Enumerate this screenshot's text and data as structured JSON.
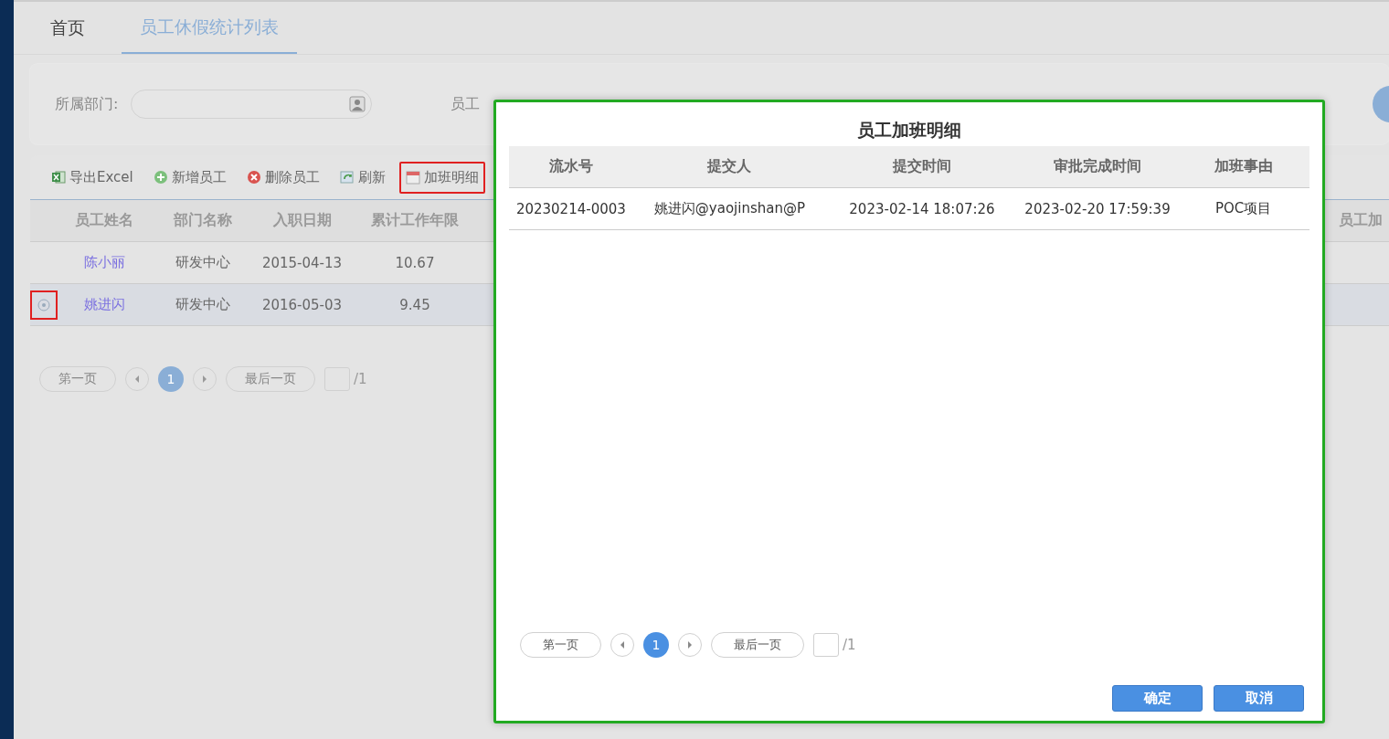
{
  "tabs": [
    {
      "label": "首页",
      "selected": false
    },
    {
      "label": "员工休假统计列表",
      "selected": true
    }
  ],
  "filter": {
    "department_label": "所属部门:",
    "employee_label": "员工"
  },
  "toolbar": [
    {
      "kind": "excel",
      "label": "导出Excel",
      "highlighted": false
    },
    {
      "kind": "add",
      "label": "新增员工",
      "highlighted": false
    },
    {
      "kind": "delete",
      "label": "删除员工",
      "highlighted": false
    },
    {
      "kind": "refresh",
      "label": "刷新",
      "highlighted": false
    },
    {
      "kind": "calendar",
      "label": "加班明细",
      "highlighted": true
    }
  ],
  "table": {
    "columns": [
      "员工姓名",
      "部门名称",
      "入职日期",
      "累计工作年限"
    ],
    "last_column": "员工加",
    "rows": [
      {
        "selected": false,
        "highlighted": false,
        "cells": [
          "陈小丽",
          "研发中心",
          "2015-04-13",
          "10.67"
        ]
      },
      {
        "selected": true,
        "highlighted": true,
        "cells": [
          "姚进闪",
          "研发中心",
          "2016-05-03",
          "9.45"
        ]
      }
    ]
  },
  "pagination": {
    "first": "第一页",
    "pages": [
      {
        "label": "1",
        "selected": true
      }
    ],
    "last": "最后一页",
    "total": "/1"
  },
  "dialog": {
    "title": "员工加班明细",
    "columns": [
      "流水号",
      "提交人",
      "提交时间",
      "审批完成时间",
      "加班事由"
    ],
    "rows": [
      [
        "20230214-0003",
        "姚进闪@yaojinshan@P",
        "2023-02-14 18:07:26",
        "2023-02-20 17:59:39",
        "POC项目"
      ]
    ],
    "pagination": {
      "first": "第一页",
      "pages": [
        {
          "label": "1",
          "selected": true
        }
      ],
      "last": "最后一页",
      "total": "/1"
    },
    "buttons": [
      "确定",
      "取消"
    ]
  }
}
